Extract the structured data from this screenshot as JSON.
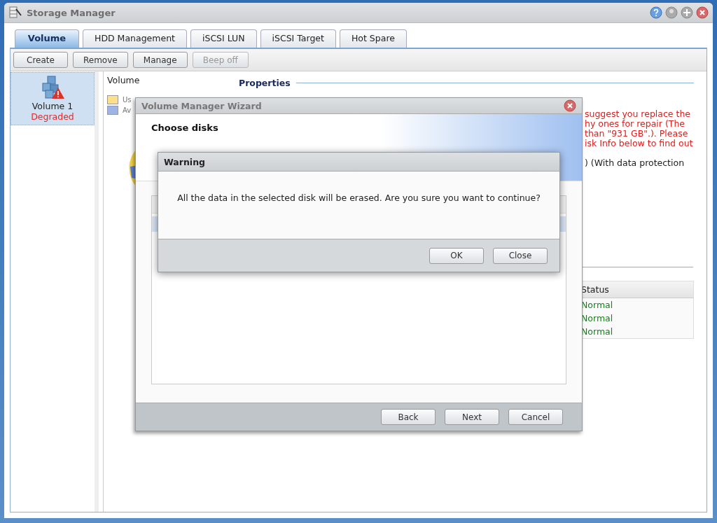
{
  "window": {
    "title": "Storage Manager"
  },
  "title_buttons": [
    {
      "kind": "help"
    },
    {
      "kind": "minimize"
    },
    {
      "kind": "maximize"
    },
    {
      "kind": "close"
    }
  ],
  "tabs": [
    {
      "label": "Volume",
      "selected": true
    },
    {
      "label": "HDD Management",
      "selected": false
    },
    {
      "label": "iSCSI LUN",
      "selected": false
    },
    {
      "label": "iSCSI Target",
      "selected": false
    },
    {
      "label": "Hot Spare",
      "selected": false
    }
  ],
  "toolbar": [
    {
      "label": "Create",
      "disabled": false
    },
    {
      "label": "Remove",
      "disabled": false
    },
    {
      "label": "Manage",
      "disabled": false
    },
    {
      "label": "Beep off",
      "disabled": true
    }
  ],
  "volumes": [
    {
      "name": "Volume 1",
      "status": "Degraded",
      "degraded": true,
      "selected": true
    }
  ],
  "content": {
    "heading": "Volume",
    "properties_title": "Properties",
    "legend": [
      {
        "label": "Us",
        "color": "#ffe08a"
      },
      {
        "label": "Av",
        "color": "#9fb4e6"
      }
    ],
    "notice_lines": [
      "suggest you replace the",
      "hy ones for repair (The",
      "than \"931 GB\".). Please",
      "isk Info below to find out"
    ],
    "raid_line": ") (With data protection",
    "disk_table": {
      "columns": [
        "Status"
      ],
      "rows": [
        {
          "status": "Normal"
        },
        {
          "status": "Normal"
        },
        {
          "status": "Normal"
        }
      ]
    }
  },
  "wizard": {
    "title": "Volume Manager Wizard",
    "step_title": "Choose disks",
    "buttons": [
      "Back",
      "Next",
      "Cancel"
    ]
  },
  "warning": {
    "title": "Warning",
    "message": "All the data in the selected disk will be erased. Are you sure you want to continue?",
    "buttons": [
      "OK",
      "Close"
    ]
  }
}
